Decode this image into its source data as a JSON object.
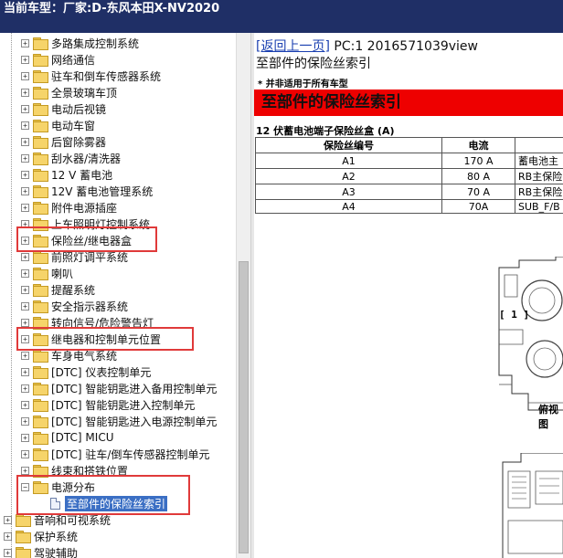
{
  "title": {
    "prefix": "当前车型：",
    "model": "厂家:D-东风本田X-NV2020"
  },
  "tree": [
    {
      "label": "多路集成控制系统",
      "expander": "+"
    },
    {
      "label": "网络通信",
      "expander": "+"
    },
    {
      "label": "驻车和倒车传感器系统",
      "expander": "+"
    },
    {
      "label": "全景玻璃车顶",
      "expander": "+"
    },
    {
      "label": "电动后视镜",
      "expander": "+"
    },
    {
      "label": "电动车窗",
      "expander": "+"
    },
    {
      "label": "后窗除雾器",
      "expander": "+"
    },
    {
      "label": "刮水器/清洗器",
      "expander": "+"
    },
    {
      "label": "12 V 蓄电池",
      "expander": "+"
    },
    {
      "label": "12V 蓄电池管理系统",
      "expander": "+"
    },
    {
      "label": "附件电源插座",
      "expander": "+"
    },
    {
      "label": "上车照明灯控制系统",
      "expander": "+"
    },
    {
      "label": "保险丝/继电器盒",
      "expander": "+"
    },
    {
      "label": "前照灯调平系统",
      "expander": "+"
    },
    {
      "label": "喇叭",
      "expander": "+"
    },
    {
      "label": "提醒系统",
      "expander": "+"
    },
    {
      "label": "安全指示器系统",
      "expander": "+"
    },
    {
      "label": "转向信号/危险警告灯",
      "expander": "+"
    },
    {
      "label": "继电器和控制单元位置",
      "expander": "+"
    },
    {
      "label": "车身电气系统",
      "expander": "+"
    },
    {
      "label": "[DTC] 仪表控制单元",
      "expander": "+"
    },
    {
      "label": "[DTC] 智能钥匙进入备用控制单元",
      "expander": "+"
    },
    {
      "label": "[DTC] 智能钥匙进入控制单元",
      "expander": "+"
    },
    {
      "label": "[DTC] 智能钥匙进入电源控制单元",
      "expander": "+"
    },
    {
      "label": "[DTC] MICU",
      "expander": "+"
    },
    {
      "label": "[DTC] 驻车/倒车传感器控制单元",
      "expander": "+"
    },
    {
      "label": "线束和搭铁位置",
      "expander": "+"
    },
    {
      "label": "电源分布",
      "expander": "−"
    }
  ],
  "tree_child": {
    "label": "至部件的保险丝索引"
  },
  "tree_top": [
    {
      "label": "音响和可视系统",
      "expander": "+"
    },
    {
      "label": "保护系统",
      "expander": "+"
    },
    {
      "label": "驾驶辅助",
      "expander": "+"
    }
  ],
  "content": {
    "back_link": "[返回上一页]",
    "pc_info": " PC:1 2016571039view",
    "page_heading": "至部件的保险丝索引",
    "note": "* 并非适用于所有车型",
    "banner": "至部件的保险丝索引",
    "section_title": "12 伏蓄电池端子保险丝盒 (A)",
    "table": {
      "headers": [
        "保险丝编号",
        "电流",
        ""
      ],
      "rows": [
        [
          "A1",
          "170 A",
          "蓄电池主"
        ],
        [
          "A2",
          "80 A",
          "RB主保险"
        ],
        [
          "A3",
          "70 A",
          "RB主保险"
        ],
        [
          "A4",
          "70A",
          "SUB_F/B"
        ]
      ]
    },
    "diagram_callout": "[ 1 ]",
    "diagram_view_label": "俯视图"
  },
  "colors": {
    "titlebar": "#1f2f66",
    "banner": "#ee0000",
    "highlight": "#e03a3a",
    "selection": "#3b6fc4",
    "link": "#1a3fb0"
  }
}
